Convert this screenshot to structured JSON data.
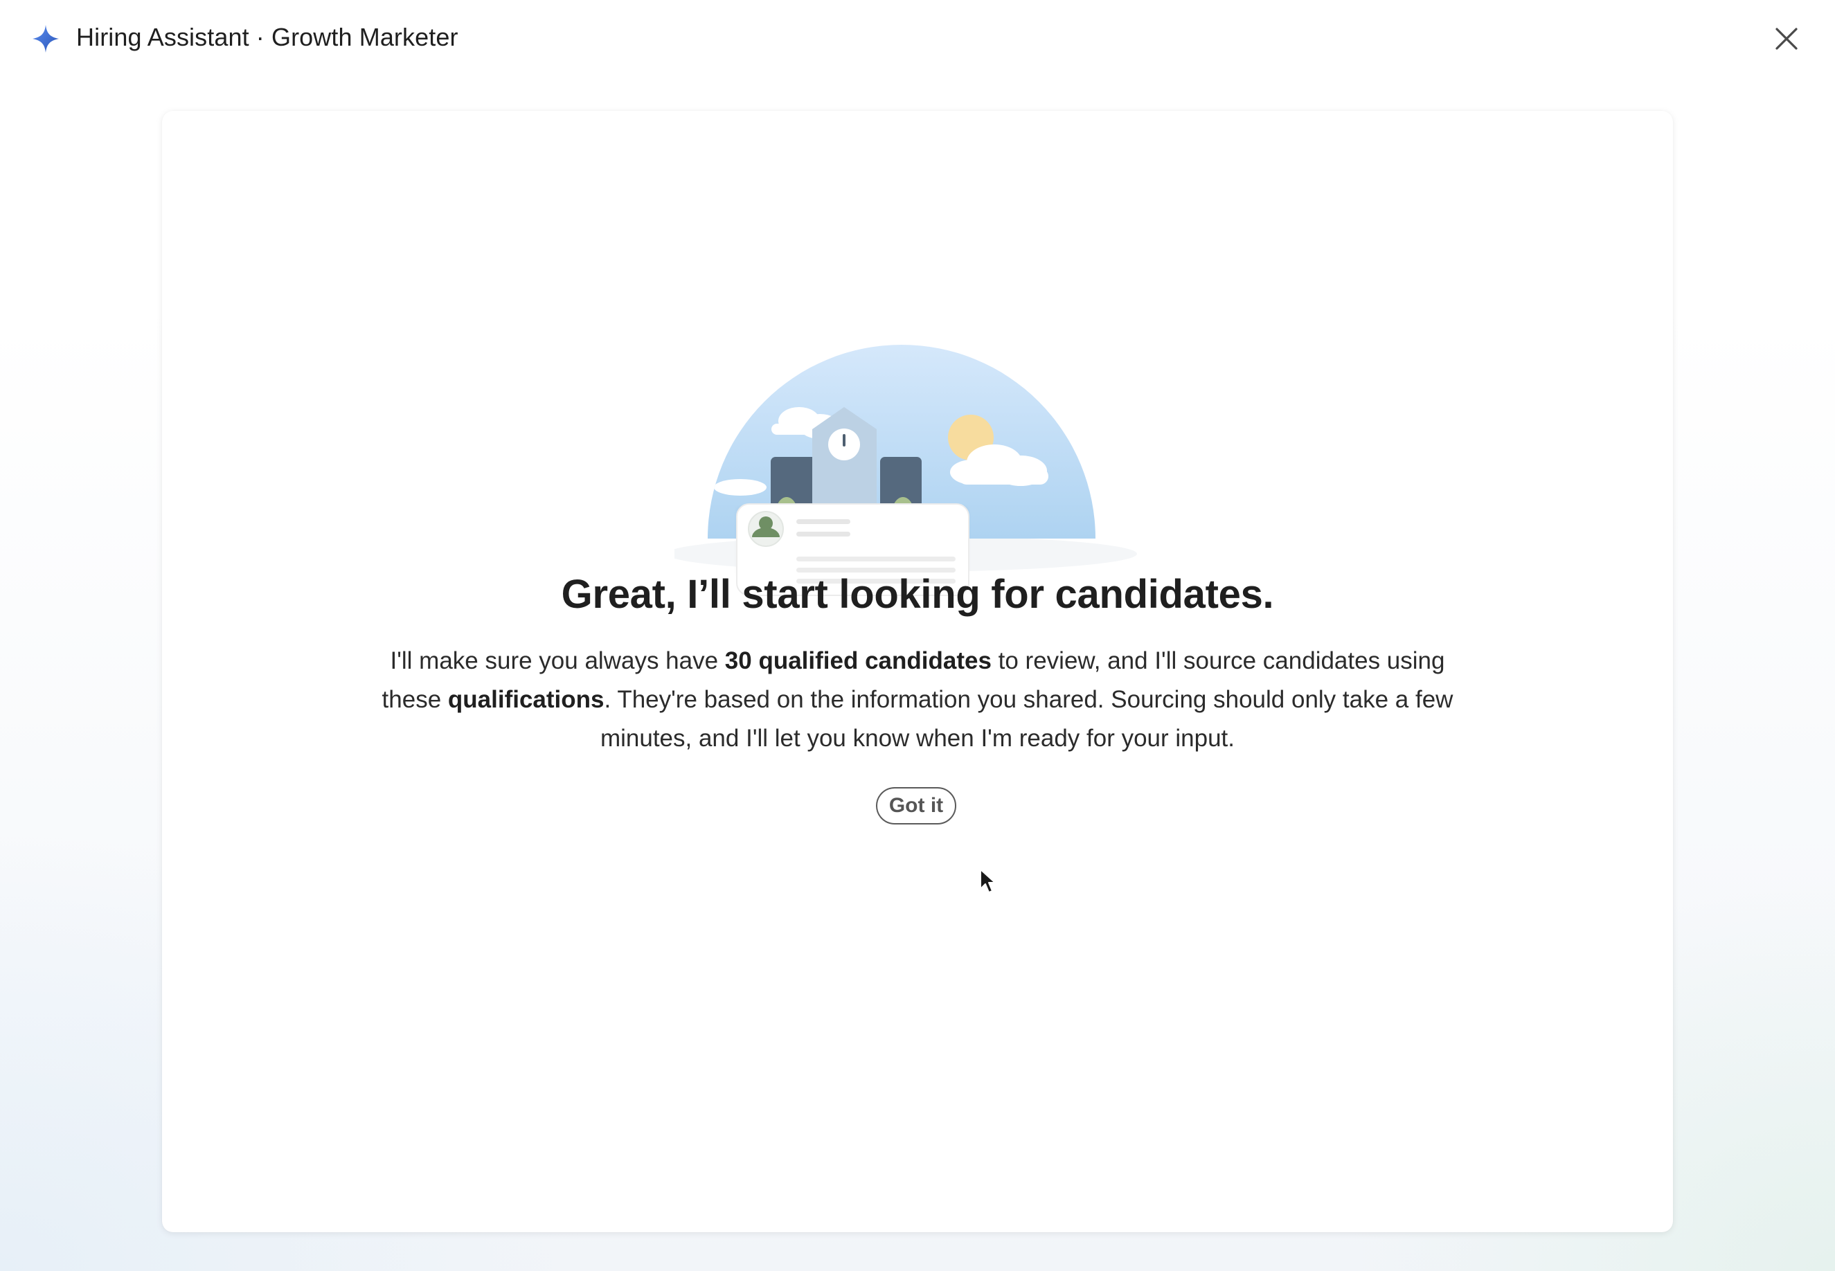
{
  "header": {
    "title": "Hiring Assistant · Growth Marketer",
    "icon": "sparkle-icon",
    "close_icon": "close-icon",
    "accent_color": "#3b6fd6"
  },
  "dialog": {
    "headline": "Great, I’ll start looking for candidates.",
    "body": {
      "part1": "I'll make sure you always have ",
      "bold1": "30 qualified candidates",
      "part2": " to review, and I'll source candidates using these ",
      "bold2": "qualifications",
      "part3": ". They're based on the information you shared. Sourcing should only take a few minutes, and I'll let you know when I'm ready for your input."
    },
    "button_label": "Got it"
  }
}
